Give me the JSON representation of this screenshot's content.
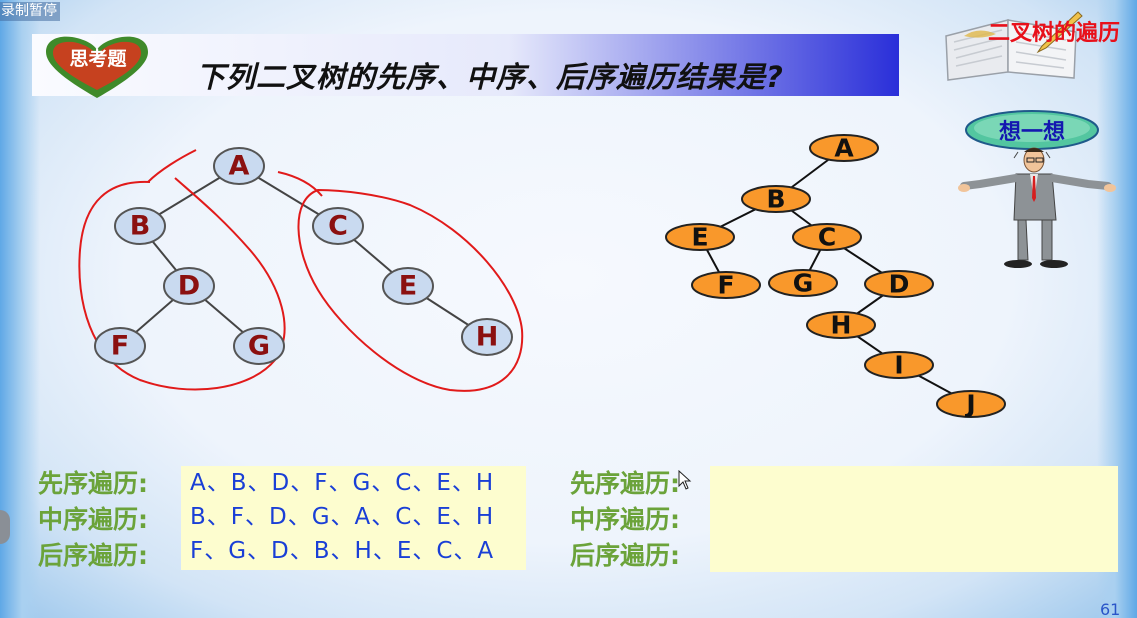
{
  "recorder": {
    "status": "录制暂停"
  },
  "slide": {
    "badge": "思考题",
    "title": "下列二叉树的先序、中序、后序遍历结果是?",
    "corner_title": "二叉树的遍历",
    "think_label": "想一想",
    "page_number": "61"
  },
  "tree_left": {
    "nodes": [
      "A",
      "B",
      "C",
      "D",
      "E",
      "F",
      "G",
      "H"
    ],
    "node_fill": "#c9daf0",
    "node_text_color": "#8b1010",
    "circle_color": "#e11a1a"
  },
  "tree_right": {
    "nodes": [
      "A",
      "B",
      "E",
      "C",
      "F",
      "G",
      "D",
      "H",
      "I",
      "J"
    ],
    "node_fill": "#f9982b"
  },
  "traversal_labels": {
    "preorder": "先序遍历:",
    "inorder": "中序遍历:",
    "postorder": "后序遍历:"
  },
  "answers_left": {
    "preorder": "A、B、D、F、G、C、E、H",
    "inorder": "B、F、D、G、A、C、E、H",
    "postorder": "F、G、D、B、H、E、C、A"
  },
  "answers_right": {
    "preorder": "",
    "inorder": "",
    "postorder": ""
  },
  "colors": {
    "banner_accent": "#2a2fd9",
    "label_green": "#6ba33a",
    "answer_blue": "#1a3fd6",
    "answer_box": "#fdfdcf",
    "heart_red": "#c6411f",
    "heart_green": "#3f8a2a"
  }
}
